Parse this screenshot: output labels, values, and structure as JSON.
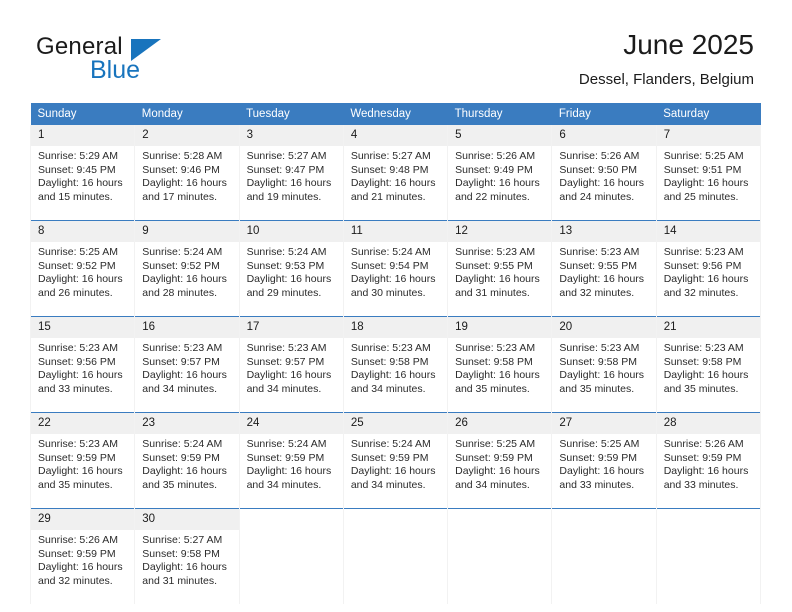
{
  "brand": {
    "name_dark": "General",
    "name_blue": "Blue",
    "accent_color": "#1874bd"
  },
  "header": {
    "title": "June 2025",
    "subtitle": "Dessel, Flanders, Belgium",
    "header_bg_color": "#3a7cc0",
    "daynum_bg_color": "#f0f0f0"
  },
  "weekday_headers": [
    "Sunday",
    "Monday",
    "Tuesday",
    "Wednesday",
    "Thursday",
    "Friday",
    "Saturday"
  ],
  "weeks": [
    [
      {
        "day": "1",
        "sunrise": "Sunrise: 5:29 AM",
        "sunset": "Sunset: 9:45 PM",
        "daylight_1": "Daylight: 16 hours",
        "daylight_2": "and 15 minutes."
      },
      {
        "day": "2",
        "sunrise": "Sunrise: 5:28 AM",
        "sunset": "Sunset: 9:46 PM",
        "daylight_1": "Daylight: 16 hours",
        "daylight_2": "and 17 minutes."
      },
      {
        "day": "3",
        "sunrise": "Sunrise: 5:27 AM",
        "sunset": "Sunset: 9:47 PM",
        "daylight_1": "Daylight: 16 hours",
        "daylight_2": "and 19 minutes."
      },
      {
        "day": "4",
        "sunrise": "Sunrise: 5:27 AM",
        "sunset": "Sunset: 9:48 PM",
        "daylight_1": "Daylight: 16 hours",
        "daylight_2": "and 21 minutes."
      },
      {
        "day": "5",
        "sunrise": "Sunrise: 5:26 AM",
        "sunset": "Sunset: 9:49 PM",
        "daylight_1": "Daylight: 16 hours",
        "daylight_2": "and 22 minutes."
      },
      {
        "day": "6",
        "sunrise": "Sunrise: 5:26 AM",
        "sunset": "Sunset: 9:50 PM",
        "daylight_1": "Daylight: 16 hours",
        "daylight_2": "and 24 minutes."
      },
      {
        "day": "7",
        "sunrise": "Sunrise: 5:25 AM",
        "sunset": "Sunset: 9:51 PM",
        "daylight_1": "Daylight: 16 hours",
        "daylight_2": "and 25 minutes."
      }
    ],
    [
      {
        "day": "8",
        "sunrise": "Sunrise: 5:25 AM",
        "sunset": "Sunset: 9:52 PM",
        "daylight_1": "Daylight: 16 hours",
        "daylight_2": "and 26 minutes."
      },
      {
        "day": "9",
        "sunrise": "Sunrise: 5:24 AM",
        "sunset": "Sunset: 9:52 PM",
        "daylight_1": "Daylight: 16 hours",
        "daylight_2": "and 28 minutes."
      },
      {
        "day": "10",
        "sunrise": "Sunrise: 5:24 AM",
        "sunset": "Sunset: 9:53 PM",
        "daylight_1": "Daylight: 16 hours",
        "daylight_2": "and 29 minutes."
      },
      {
        "day": "11",
        "sunrise": "Sunrise: 5:24 AM",
        "sunset": "Sunset: 9:54 PM",
        "daylight_1": "Daylight: 16 hours",
        "daylight_2": "and 30 minutes."
      },
      {
        "day": "12",
        "sunrise": "Sunrise: 5:23 AM",
        "sunset": "Sunset: 9:55 PM",
        "daylight_1": "Daylight: 16 hours",
        "daylight_2": "and 31 minutes."
      },
      {
        "day": "13",
        "sunrise": "Sunrise: 5:23 AM",
        "sunset": "Sunset: 9:55 PM",
        "daylight_1": "Daylight: 16 hours",
        "daylight_2": "and 32 minutes."
      },
      {
        "day": "14",
        "sunrise": "Sunrise: 5:23 AM",
        "sunset": "Sunset: 9:56 PM",
        "daylight_1": "Daylight: 16 hours",
        "daylight_2": "and 32 minutes."
      }
    ],
    [
      {
        "day": "15",
        "sunrise": "Sunrise: 5:23 AM",
        "sunset": "Sunset: 9:56 PM",
        "daylight_1": "Daylight: 16 hours",
        "daylight_2": "and 33 minutes."
      },
      {
        "day": "16",
        "sunrise": "Sunrise: 5:23 AM",
        "sunset": "Sunset: 9:57 PM",
        "daylight_1": "Daylight: 16 hours",
        "daylight_2": "and 34 minutes."
      },
      {
        "day": "17",
        "sunrise": "Sunrise: 5:23 AM",
        "sunset": "Sunset: 9:57 PM",
        "daylight_1": "Daylight: 16 hours",
        "daylight_2": "and 34 minutes."
      },
      {
        "day": "18",
        "sunrise": "Sunrise: 5:23 AM",
        "sunset": "Sunset: 9:58 PM",
        "daylight_1": "Daylight: 16 hours",
        "daylight_2": "and 34 minutes."
      },
      {
        "day": "19",
        "sunrise": "Sunrise: 5:23 AM",
        "sunset": "Sunset: 9:58 PM",
        "daylight_1": "Daylight: 16 hours",
        "daylight_2": "and 35 minutes."
      },
      {
        "day": "20",
        "sunrise": "Sunrise: 5:23 AM",
        "sunset": "Sunset: 9:58 PM",
        "daylight_1": "Daylight: 16 hours",
        "daylight_2": "and 35 minutes."
      },
      {
        "day": "21",
        "sunrise": "Sunrise: 5:23 AM",
        "sunset": "Sunset: 9:58 PM",
        "daylight_1": "Daylight: 16 hours",
        "daylight_2": "and 35 minutes."
      }
    ],
    [
      {
        "day": "22",
        "sunrise": "Sunrise: 5:23 AM",
        "sunset": "Sunset: 9:59 PM",
        "daylight_1": "Daylight: 16 hours",
        "daylight_2": "and 35 minutes."
      },
      {
        "day": "23",
        "sunrise": "Sunrise: 5:24 AM",
        "sunset": "Sunset: 9:59 PM",
        "daylight_1": "Daylight: 16 hours",
        "daylight_2": "and 35 minutes."
      },
      {
        "day": "24",
        "sunrise": "Sunrise: 5:24 AM",
        "sunset": "Sunset: 9:59 PM",
        "daylight_1": "Daylight: 16 hours",
        "daylight_2": "and 34 minutes."
      },
      {
        "day": "25",
        "sunrise": "Sunrise: 5:24 AM",
        "sunset": "Sunset: 9:59 PM",
        "daylight_1": "Daylight: 16 hours",
        "daylight_2": "and 34 minutes."
      },
      {
        "day": "26",
        "sunrise": "Sunrise: 5:25 AM",
        "sunset": "Sunset: 9:59 PM",
        "daylight_1": "Daylight: 16 hours",
        "daylight_2": "and 34 minutes."
      },
      {
        "day": "27",
        "sunrise": "Sunrise: 5:25 AM",
        "sunset": "Sunset: 9:59 PM",
        "daylight_1": "Daylight: 16 hours",
        "daylight_2": "and 33 minutes."
      },
      {
        "day": "28",
        "sunrise": "Sunrise: 5:26 AM",
        "sunset": "Sunset: 9:59 PM",
        "daylight_1": "Daylight: 16 hours",
        "daylight_2": "and 33 minutes."
      }
    ],
    [
      {
        "day": "29",
        "sunrise": "Sunrise: 5:26 AM",
        "sunset": "Sunset: 9:59 PM",
        "daylight_1": "Daylight: 16 hours",
        "daylight_2": "and 32 minutes."
      },
      {
        "day": "30",
        "sunrise": "Sunrise: 5:27 AM",
        "sunset": "Sunset: 9:58 PM",
        "daylight_1": "Daylight: 16 hours",
        "daylight_2": "and 31 minutes."
      },
      {
        "day": "",
        "sunrise": "",
        "sunset": "",
        "daylight_1": "",
        "daylight_2": ""
      },
      {
        "day": "",
        "sunrise": "",
        "sunset": "",
        "daylight_1": "",
        "daylight_2": ""
      },
      {
        "day": "",
        "sunrise": "",
        "sunset": "",
        "daylight_1": "",
        "daylight_2": ""
      },
      {
        "day": "",
        "sunrise": "",
        "sunset": "",
        "daylight_1": "",
        "daylight_2": ""
      },
      {
        "day": "",
        "sunrise": "",
        "sunset": "",
        "daylight_1": "",
        "daylight_2": ""
      }
    ]
  ]
}
